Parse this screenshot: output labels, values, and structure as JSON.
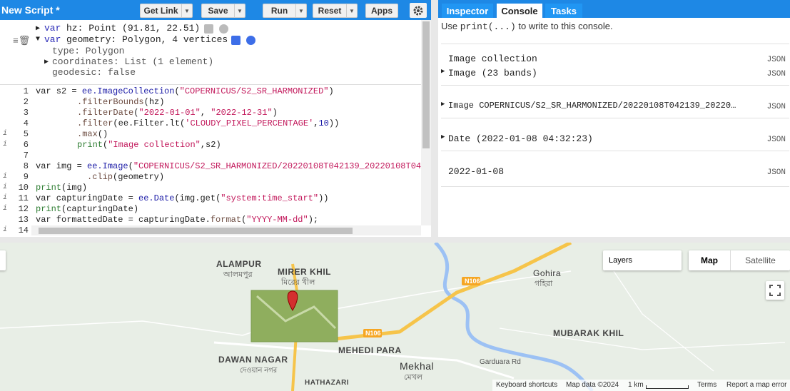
{
  "header": {
    "title": "New Script *",
    "buttons": {
      "get_link": "Get Link",
      "save": "Save",
      "run": "Run",
      "reset": "Reset",
      "apps": "Apps"
    }
  },
  "tabs": {
    "inspector": "Inspector",
    "console": "Console",
    "tasks": "Tasks"
  },
  "inspector": {
    "line1_kw": "var",
    "line1": "hz: Point (91.81, 22.51)",
    "line2_kw": "var",
    "line2": "geometry: Polygon, 4 vertices",
    "line3": "type: Polygon",
    "line4": "coordinates: List (1 element)",
    "line5": "geodesic: false"
  },
  "code": {
    "lines": [
      "1",
      "2",
      "3",
      "4",
      "5",
      "6",
      "7",
      "8",
      "9",
      "10",
      "11",
      "12",
      "13",
      "14"
    ],
    "l1a": "var s2 = ",
    "l1b": "ee.ImageCollection",
    "l1c": "(",
    "l1d": "\"COPERNICUS/S2_SR_HARMONIZED\"",
    "l1e": ")",
    "l2a": ".filterBounds",
    "l2b": "(hz)",
    "l3a": ".filterDate",
    "l3b": "(",
    "l3c": "\"2022-01-01\"",
    "l3d": ", ",
    "l3e": "\"2022-12-31\"",
    "l3f": ")",
    "l4a": ".filter",
    "l4b": "(ee.Filter.lt(",
    "l4c": "'CLOUDY_PIXEL_PERCENTAGE'",
    "l4d": ",",
    "l4e": "10",
    "l4f": "))",
    "l5a": ".max",
    "l5b": "()",
    "l6a": "print",
    "l6b": "(",
    "l6c": "\"Image collection\"",
    "l6d": ",s2)",
    "l8a": "var img = ",
    "l8b": "ee.Image",
    "l8c": "(",
    "l8d": "\"COPERNICUS/S2_SR_HARMONIZED/20220108T042139_20220108T04",
    "l9a": ".clip",
    "l9b": "(geometry)",
    "l10a": "print",
    "l10b": "(img)",
    "l11a": "var capturingDate = ",
    "l11b": "ee.Date",
    "l11c": "(img.get(",
    "l11d": "\"system:time_start\"",
    "l11e": "))",
    "l12a": "print",
    "l12b": "(capturingDate)",
    "l13a": "var formattedDate = capturingDate.",
    "l13b": "format",
    "l13c": "(",
    "l13d": "\"YYYY-MM-dd\"",
    "l13e": ");"
  },
  "console": {
    "hint_a": "Use ",
    "hint_code": "print(...)",
    "hint_b": " to write to this console.",
    "r1": "Image collection",
    "r2": "Image (23 bands)",
    "r3": "Image COPERNICUS/S2_SR_HARMONIZED/20220108T042139_20220…",
    "r4": "Date (2022-01-08 04:32:23)",
    "r5": "2022-01-08",
    "json": "JSON"
  },
  "map": {
    "places": [
      {
        "en": "ALAMPUR",
        "bn": "আলমপুর"
      },
      {
        "en": "MIRER KHIL",
        "bn": "মিরের খীল"
      },
      {
        "en": "Gohira",
        "bn": "গহিরা"
      },
      {
        "en": "MUBARAK KHIL",
        "bn": ""
      },
      {
        "en": "DAWAN NAGAR",
        "bn": "দেওয়ান নগর"
      },
      {
        "en": "MEHEDI PARA",
        "bn": ""
      },
      {
        "en": "Mekhal",
        "bn": "মেখল"
      },
      {
        "en": "HATHAZARI",
        "bn": ""
      },
      {
        "en": "Garduara Rd",
        "bn": ""
      }
    ],
    "roads": {
      "n106a": "N106",
      "n106b": "N106"
    },
    "layers": "Layers",
    "map_btn": "Map",
    "satellite_btn": "Satellite",
    "footer": {
      "shortcuts": "Keyboard shortcuts",
      "data": "Map data ©2024",
      "scale": "1 km",
      "terms": "Terms",
      "report": "Report a map error"
    }
  }
}
